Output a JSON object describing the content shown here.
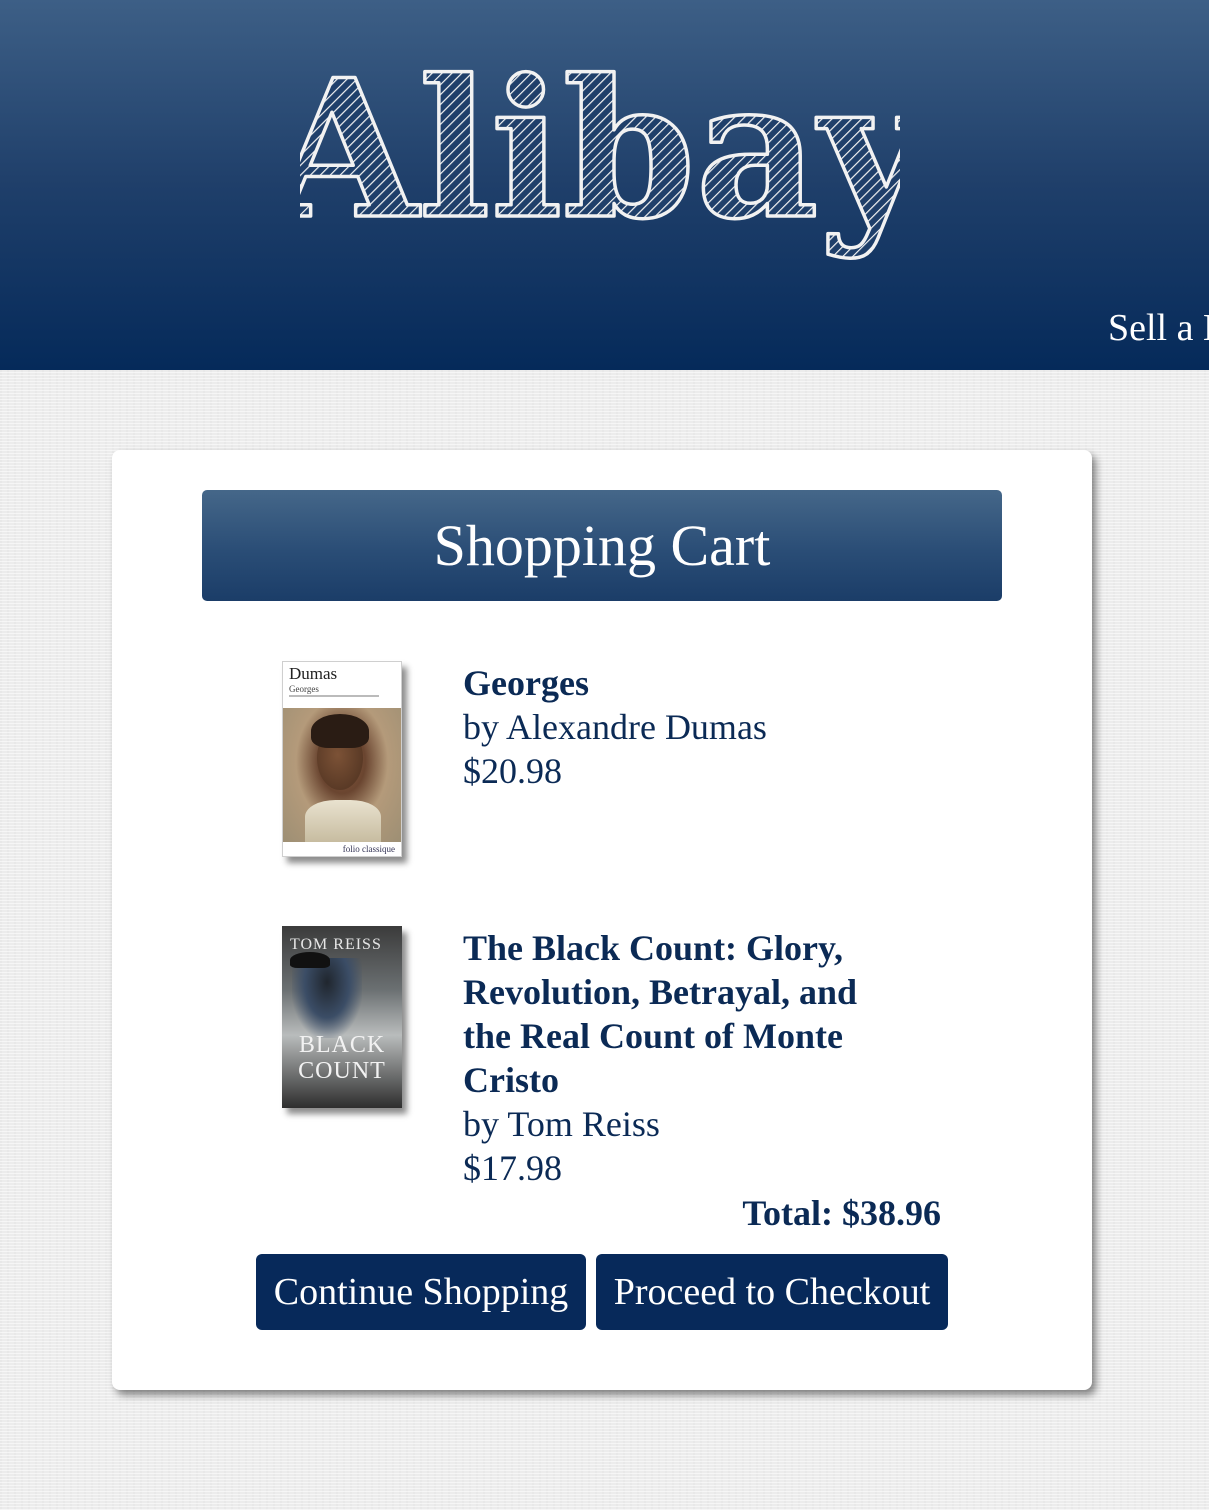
{
  "header": {
    "logo_text": "Alibay",
    "nav_link": "Sell a Book",
    "colors": {
      "top": "#3d5f86",
      "bottom": "#052a5a",
      "accent": "#07295a",
      "text": "#0b2a55"
    }
  },
  "cart": {
    "title": "Shopping Cart",
    "items": [
      {
        "title": "Georges",
        "author_line": "by Alexandre Dumas",
        "price": "$20.98",
        "cover": {
          "author": "Dumas",
          "subtitle": "Georges",
          "publisher": "folio classique"
        }
      },
      {
        "title": "The Black Count: Glory, Revolution, Betrayal, and the Real Count of Monte Cristo",
        "author_line": "by Tom Reiss",
        "price": "$17.98",
        "cover": {
          "author": "TOM REISS",
          "title_line1": "BLACK",
          "title_line2": "COUNT"
        }
      }
    ],
    "total_line": "Total: $38.96",
    "buttons": {
      "continue_label": "Continue Shopping",
      "checkout_label": "Proceed to Checkout"
    }
  }
}
